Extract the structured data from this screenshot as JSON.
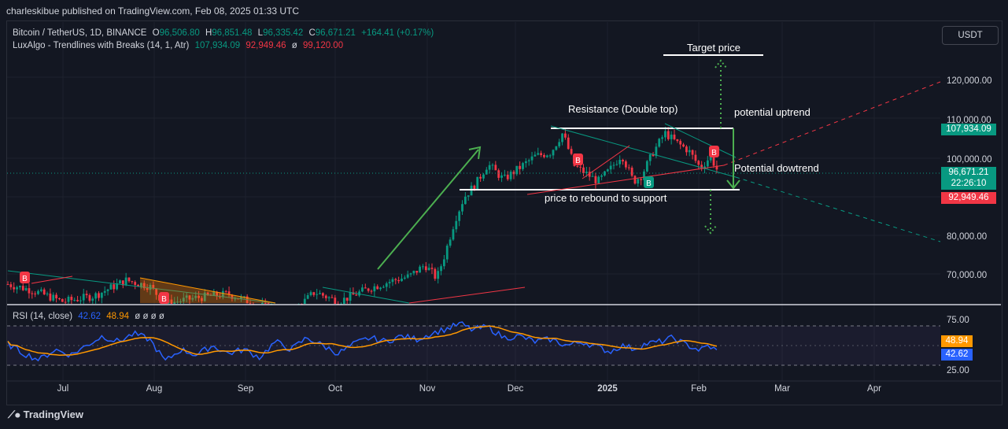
{
  "header": {
    "published": "charleskibue published on TradingView.com, Feb 08, 2025 01:33 UTC",
    "currency_button": "USDT"
  },
  "legend": {
    "symbol": "Bitcoin / TetherUS, 1D, BINANCE",
    "open_label": "O",
    "open": "96,506.80",
    "high_label": "H",
    "high": "96,851.48",
    "low_label": "L",
    "low": "96,335.42",
    "close_label": "C",
    "close": "96,671.21",
    "change": "+164.41 (+0.17%)",
    "indicator": "LuxAlgo - Trendlines with Breaks (14, 1, Atr)",
    "ind_v1": "107,934.09",
    "ind_v2": "92,949.46",
    "ind_v3_sym": "ø",
    "ind_v3": "99,120.00",
    "rsi": "RSI (14, close)",
    "rsi_v1": "42.62",
    "rsi_v2": "48.94",
    "rsi_nulls": "ø ø ø ø"
  },
  "annotations": {
    "target": "Target price",
    "resistance": "Resistance (Double top)",
    "uptrend": "potential uptrend",
    "downtrend": "Potential dowtrend",
    "support": "price to rebound to support"
  },
  "price_axis": {
    "ticks": [
      "120,000.00",
      "110,000.00",
      "100,000.00",
      "80,000.00",
      "70,000.00"
    ],
    "labels": [
      {
        "text": "107,934.09",
        "color": "#089981"
      },
      {
        "text": "96,671.21",
        "color": "#089981"
      },
      {
        "text": "22:26:10",
        "color": "#089981"
      },
      {
        "text": "92,949.46",
        "color": "#f23645"
      }
    ]
  },
  "rsi_axis": {
    "ticks": [
      "75.00",
      "25.00"
    ],
    "labels": [
      {
        "text": "48.94",
        "color": "#ff9800"
      },
      {
        "text": "42.62",
        "color": "#2962ff"
      }
    ]
  },
  "time_axis": [
    "Jul",
    "Aug",
    "Sep",
    "Oct",
    "Nov",
    "Dec",
    "2025",
    "Feb",
    "Mar",
    "Apr"
  ],
  "markers": [
    "B",
    "B",
    "B",
    "B",
    "B"
  ],
  "footer": {
    "brand": "TradingView"
  },
  "colors": {
    "up": "#089981",
    "down": "#f23645",
    "arrow": "#4caf50",
    "rsi": "#2962ff",
    "rsi_ma": "#ff9800"
  },
  "chart_data": {
    "type": "candlestick",
    "title": "Bitcoin / TetherUS, 1D, BINANCE",
    "ylim": [
      62000,
      127000
    ],
    "x": [
      "Jul",
      "Aug",
      "Sep",
      "Oct",
      "Nov",
      "Dec",
      "2025",
      "Feb"
    ],
    "series": [
      {
        "name": "Bitcoin / TetherUS",
        "values": [
          63000,
          66000,
          58000,
          61000,
          70000,
          98000,
          94000,
          96671
        ]
      }
    ],
    "rsi": {
      "ylim": [
        25,
        75
      ],
      "last": 42.62,
      "ma_last": 48.94
    },
    "levels": {
      "resistance": 108000,
      "support": 92000,
      "target": 125000,
      "down_target": 81000
    }
  }
}
